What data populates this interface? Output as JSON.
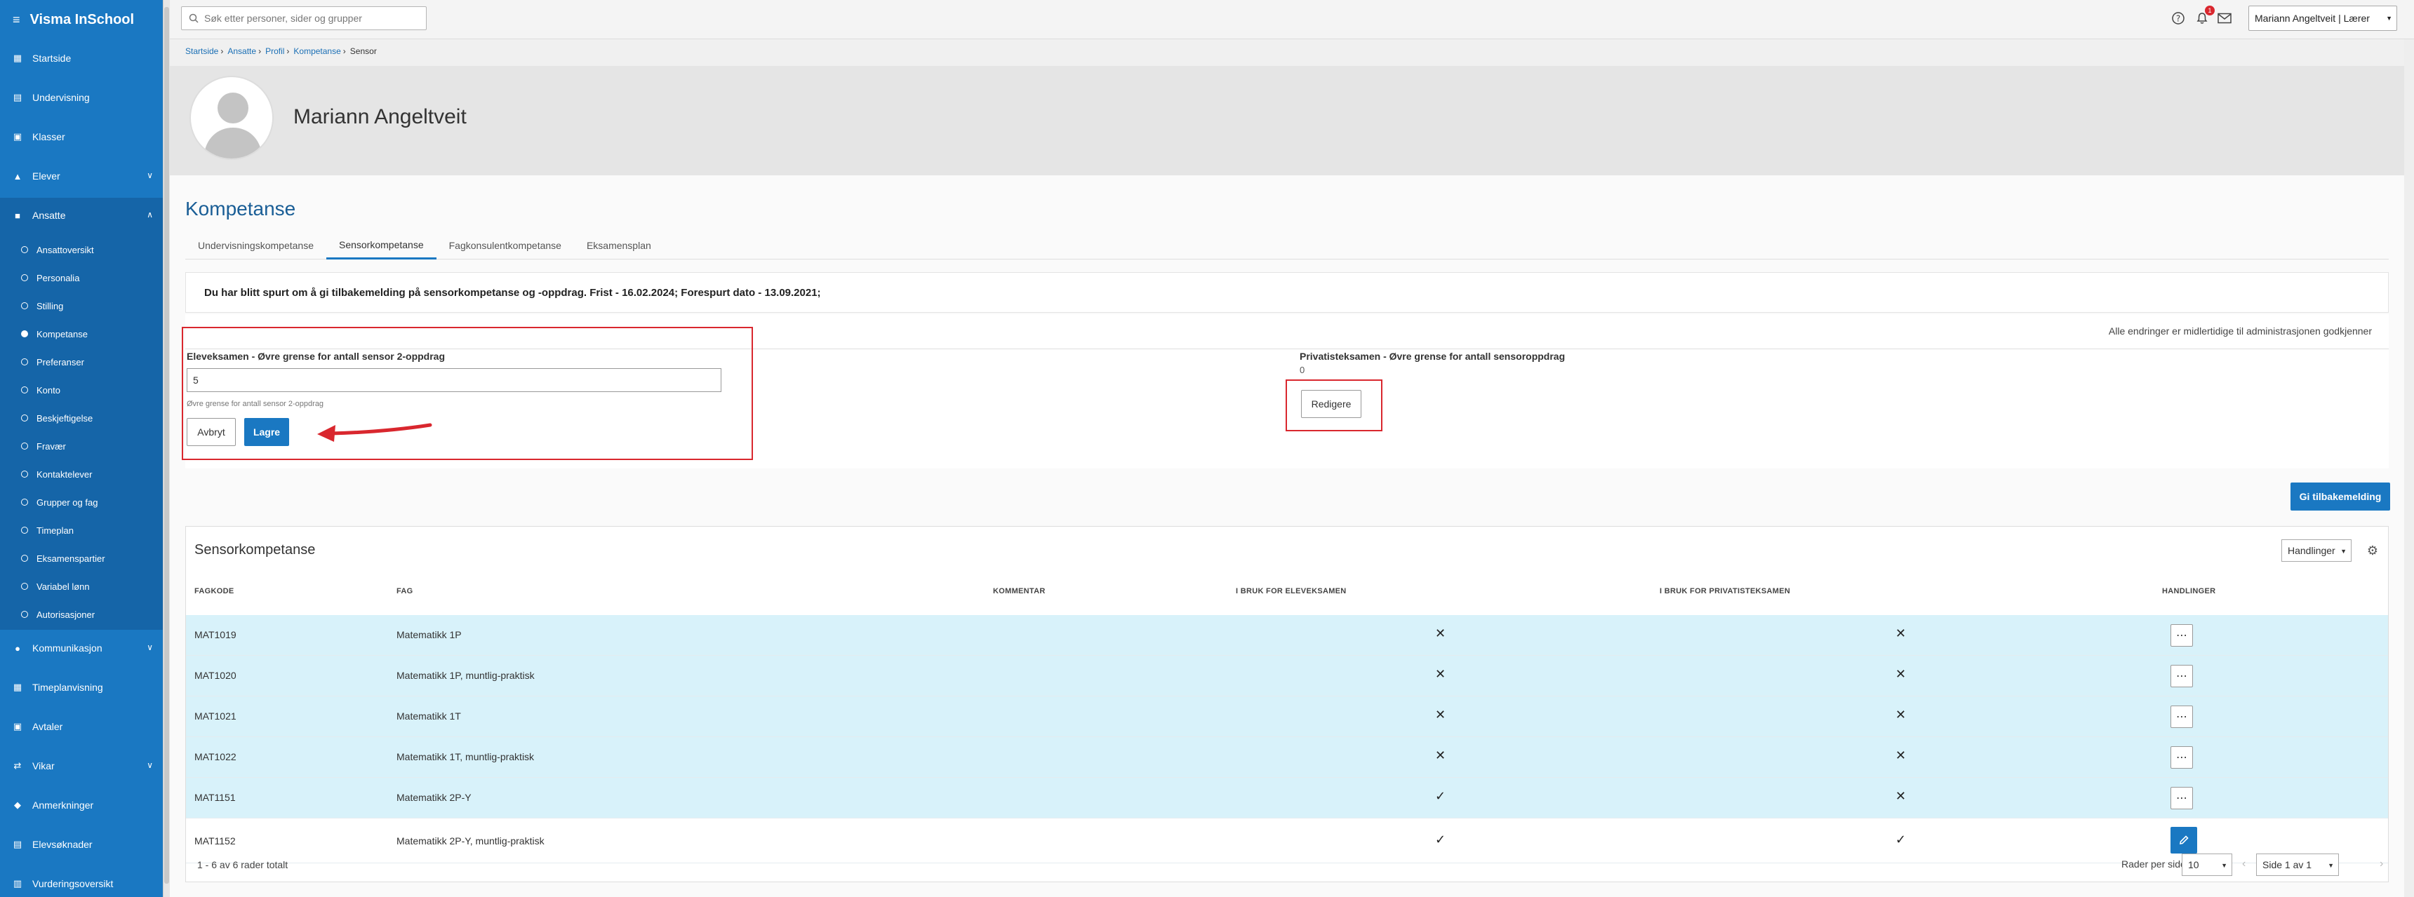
{
  "app": {
    "title": "Visma InSchool"
  },
  "sidebar": {
    "items": [
      {
        "label": "Startside",
        "icon": "grid-icon"
      },
      {
        "label": "Undervisning",
        "icon": "book-icon"
      },
      {
        "label": "Klasser",
        "icon": "classes-icon"
      },
      {
        "label": "Elever",
        "icon": "graduation-icon"
      },
      {
        "label": "Ansatte",
        "icon": "briefcase-icon"
      },
      {
        "label": "Kommunikasjon",
        "icon": "chat-icon"
      },
      {
        "label": "Timeplanvisning",
        "icon": "calendar-icon"
      },
      {
        "label": "Avtaler",
        "icon": "calendar-check-icon"
      },
      {
        "label": "Vikar",
        "icon": "swap-icon"
      },
      {
        "label": "Anmerkninger",
        "icon": "bell-icon"
      },
      {
        "label": "Elevsøknader",
        "icon": "inbox-icon"
      },
      {
        "label": "Vurderingsoversikt",
        "icon": "chart-icon"
      }
    ],
    "submenu": [
      "Ansattoversikt",
      "Personalia",
      "Stilling",
      "Kompetanse",
      "Preferanser",
      "Konto",
      "Beskjeftigelse",
      "Fravær",
      "Kontaktelever",
      "Grupper og fag",
      "Timeplan",
      "Eksamenspartier",
      "Variabel lønn",
      "Autorisasjoner"
    ]
  },
  "topbar": {
    "search_placeholder": "Søk etter personer, sider og grupper",
    "notification_count": "1",
    "user_label": "Mariann Angeltveit | Lærer"
  },
  "breadcrumb": [
    "Startside",
    "Ansatte",
    "Profil",
    "Kompetanse",
    "Sensor"
  ],
  "profile": {
    "name": "Mariann Angeltveit"
  },
  "page": {
    "title": "Kompetanse",
    "tabs": [
      "Undervisningskompetanse",
      "Sensorkompetanse",
      "Fagkonsulentkompetanse",
      "Eksamensplan"
    ],
    "notice": "Du har blitt spurt om å gi tilbakemelding på sensorkompetanse og -oppdrag. Frist - 16.02.2024; Forespurt dato - 13.09.2021;",
    "pending_note": "Alle endringer er midlertidige til administrasjonen godkjenner"
  },
  "form": {
    "elev_label": "Eleveksamen - Øvre grense for antall sensor 2-oppdrag",
    "elev_value": "5",
    "elev_help": "Øvre grense for antall sensor 2-oppdrag",
    "cancel_label": "Avbryt",
    "save_label": "Lagre",
    "priv_label": "Privatisteksamen - Øvre grense for antall sensoroppdrag",
    "priv_value": "0",
    "edit_label": "Redigere",
    "feedback_label": "Gi tilbakemelding"
  },
  "table": {
    "title": "Sensorkompetanse",
    "actions_label": "Handlinger",
    "columns": [
      "FAGKODE",
      "FAG",
      "KOMMENTAR",
      "I BRUK FOR ELEVEKSAMEN",
      "I BRUK FOR PRIVATISTEKSAMEN",
      "HANDLINGER"
    ],
    "rows": [
      {
        "code": "MAT1019",
        "subject": "Matematikk 1P",
        "comment": "",
        "elev": "✕",
        "priv": "✕",
        "selected": true
      },
      {
        "code": "MAT1020",
        "subject": "Matematikk 1P, muntlig-praktisk",
        "comment": "",
        "elev": "✕",
        "priv": "✕",
        "selected": true
      },
      {
        "code": "MAT1021",
        "subject": "Matematikk 1T",
        "comment": "",
        "elev": "✕",
        "priv": "✕",
        "selected": true
      },
      {
        "code": "MAT1022",
        "subject": "Matematikk 1T, muntlig-praktisk",
        "comment": "",
        "elev": "✕",
        "priv": "✕",
        "selected": true
      },
      {
        "code": "MAT1151",
        "subject": "Matematikk 2P-Y",
        "comment": "",
        "elev": "✓",
        "priv": "✕",
        "selected": true
      },
      {
        "code": "MAT1152",
        "subject": "Matematikk 2P-Y, muntlig-praktisk",
        "comment": "",
        "elev": "✓",
        "priv": "✓",
        "selected": false
      }
    ],
    "summary": "1 - 6 av 6 rader totalt",
    "rows_per_page_label": "Rader per side",
    "rows_per_page": "10",
    "page_label": "Side 1 av 1"
  },
  "colors": {
    "brand": "#1a78c2",
    "annotation": "#d9272e",
    "selected_row": "#d8f2fa"
  }
}
